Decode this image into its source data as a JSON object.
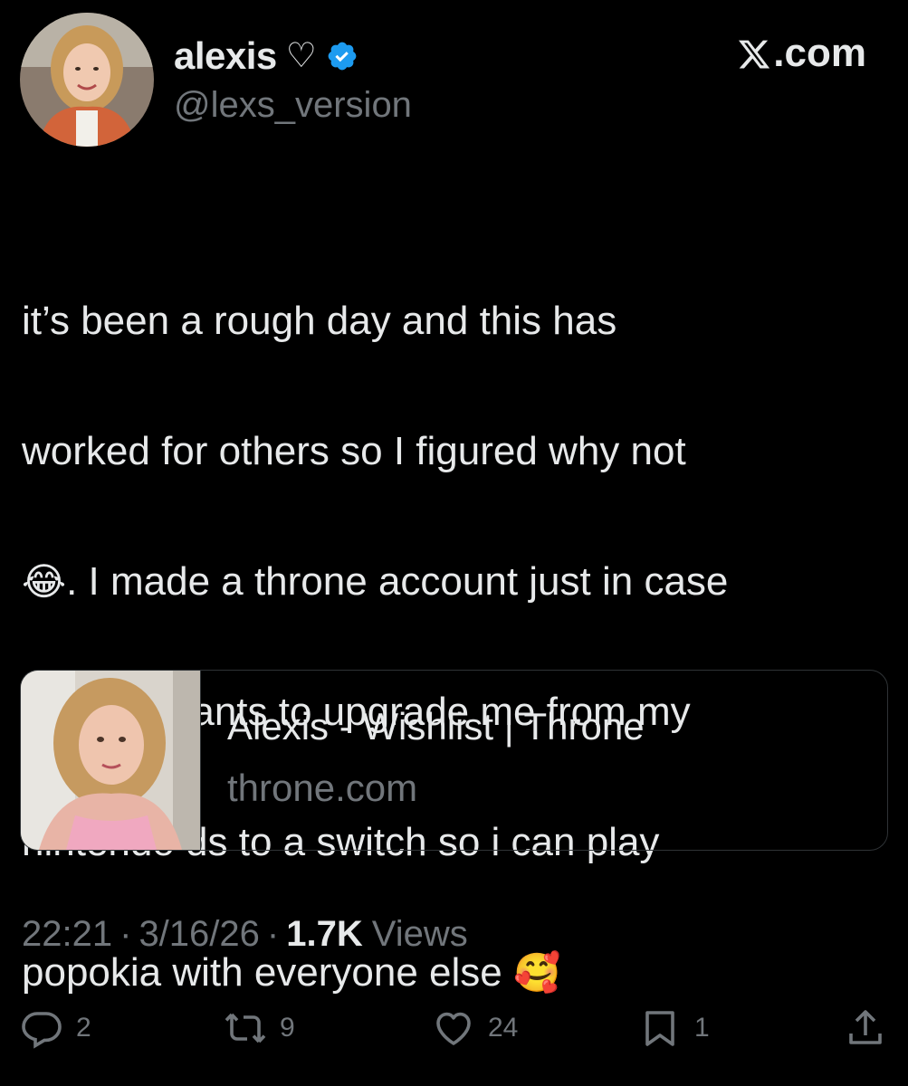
{
  "author": {
    "display_name": "alexis",
    "name_suffix": "♡",
    "handle": "@lexs_version",
    "verified_icon": "verified-badge-icon",
    "avatar_icon": "profile-photo"
  },
  "site": {
    "label": ".com",
    "logo": "x-logo-icon"
  },
  "tweet": {
    "line1": "it’s been a rough day and this has",
    "line2": "worked for others so I figured why not",
    "line3_emoji": "😂",
    "line3_text": ". I made a throne account just in case",
    "line4": "anyone wants to upgrade me from my",
    "line5": "nintendo ds to a switch so i can play",
    "line6_text": "popokia with everyone else ",
    "line6_emoji": "🥰"
  },
  "link_card": {
    "title": "Alexis - Wishlist | Throne",
    "domain": "throne.com"
  },
  "meta": {
    "time": "22:21",
    "date": "3/16/26",
    "separator": "·",
    "views_count": "1.7K",
    "views_label": "Views"
  },
  "actions": {
    "replies": "2",
    "reposts": "9",
    "likes": "24",
    "bookmarks": "1"
  },
  "colors": {
    "background": "#000000",
    "text_primary": "#e7e9ea",
    "text_secondary": "#71767b",
    "verified_blue": "#1d9bf0",
    "border": "#2f3336"
  }
}
